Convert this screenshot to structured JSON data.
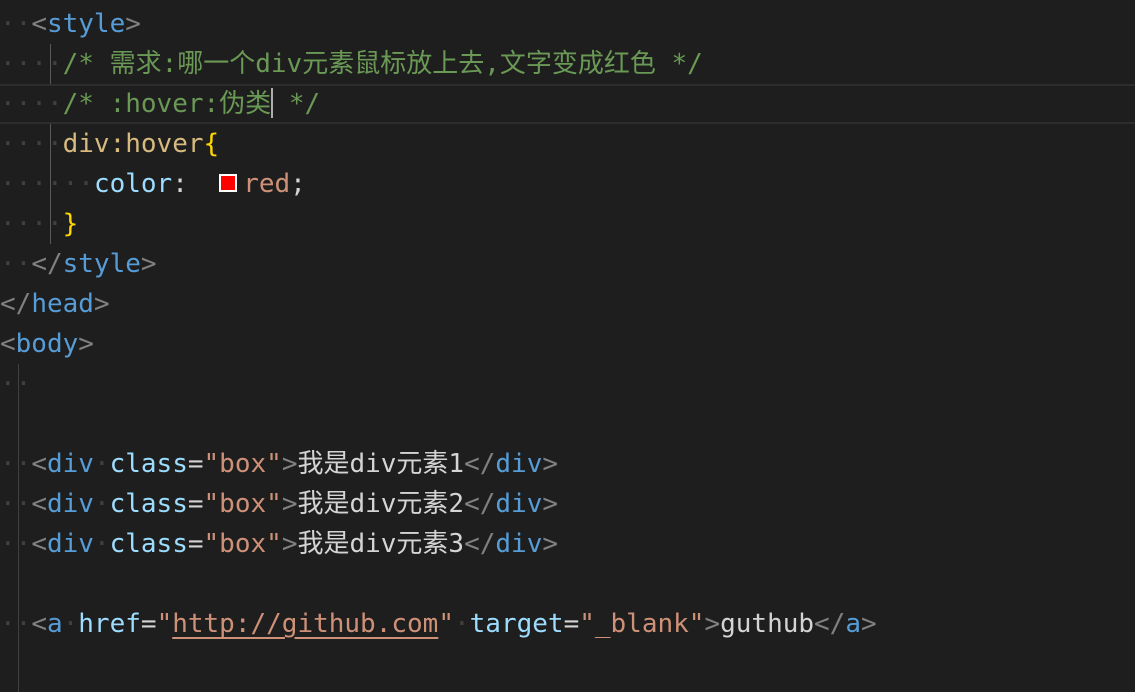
{
  "code": {
    "style_open_tag": "style",
    "comment_requirement": "/* 需求:哪一个div元素鼠标放上去,文字变成红色 */",
    "comment_hover_prefix": "/* :hover:伪类",
    "comment_hover_suffix": " */",
    "selector": "div:hover",
    "open_brace": "{",
    "property": "color",
    "colon": ": ",
    "value": "red",
    "semicolon": ";",
    "swatch_color": "#ff0000",
    "close_brace": "}",
    "style_close_tag": "style",
    "head_close_tag": "head",
    "body_open_tag": "body",
    "div_tag": "div",
    "class_attr": "class",
    "class_value": "\"box\"",
    "div_text_1": "我是div元素1",
    "div_text_2": "我是div元素2",
    "div_text_3": "我是div元素3",
    "a_tag": "a",
    "href_attr": "href",
    "href_value_open_quote": "\"",
    "href_value": "http://github.com",
    "href_value_close_quote": "\"",
    "target_attr": "target",
    "target_value": "\"_blank\"",
    "a_text": "guthub"
  }
}
